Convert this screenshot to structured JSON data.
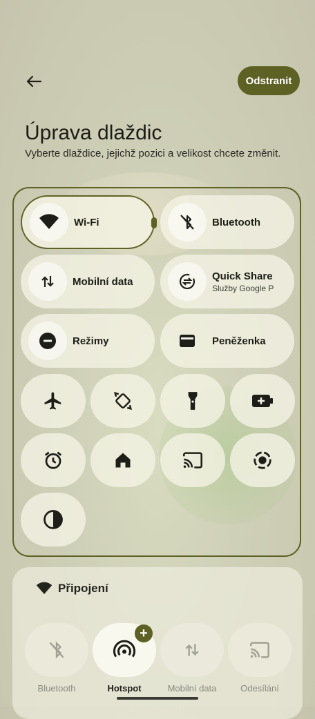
{
  "header": {
    "back_icon": "arrow-back-icon",
    "remove_label": "Odstranit"
  },
  "title": "Úprava dlaždic",
  "subtitle": "Vyberte dlaždice, jejichž pozici a velikost chcete změnit.",
  "tiles": {
    "wifi": {
      "label": "Wi‑Fi",
      "icon": "wifi-icon"
    },
    "bluetooth": {
      "label": "Bluetooth",
      "icon": "bluetooth-off-icon"
    },
    "mobile_data": {
      "label": "Mobilní data",
      "icon": "mobile-data-icon"
    },
    "quick_share": {
      "label": "Quick Share",
      "sublabel": "Služby Google P",
      "icon": "quick-share-icon"
    },
    "modes": {
      "label": "Režimy",
      "icon": "do-not-disturb-icon"
    },
    "wallet": {
      "label": "Peněženka",
      "icon": "wallet-icon"
    }
  },
  "small_tiles": [
    "airplane-icon",
    "auto-rotate-icon",
    "flashlight-icon",
    "battery-saver-icon",
    "alarm-icon",
    "home-icon",
    "cast-icon",
    "screen-record-icon",
    "color-inversion-icon"
  ],
  "available": {
    "section_title": "Připojení",
    "section_icon": "wifi-icon",
    "items": [
      {
        "label": "Bluetooth",
        "icon": "bluetooth-off-icon"
      },
      {
        "label": "Hotspot",
        "icon": "hotspot-icon"
      },
      {
        "label": "Mobilní data",
        "icon": "mobile-data-icon"
      },
      {
        "label": "Odesílání",
        "icon": "cast-icon"
      }
    ],
    "add_badge": "+"
  },
  "colors": {
    "accent": "#5e6124"
  }
}
